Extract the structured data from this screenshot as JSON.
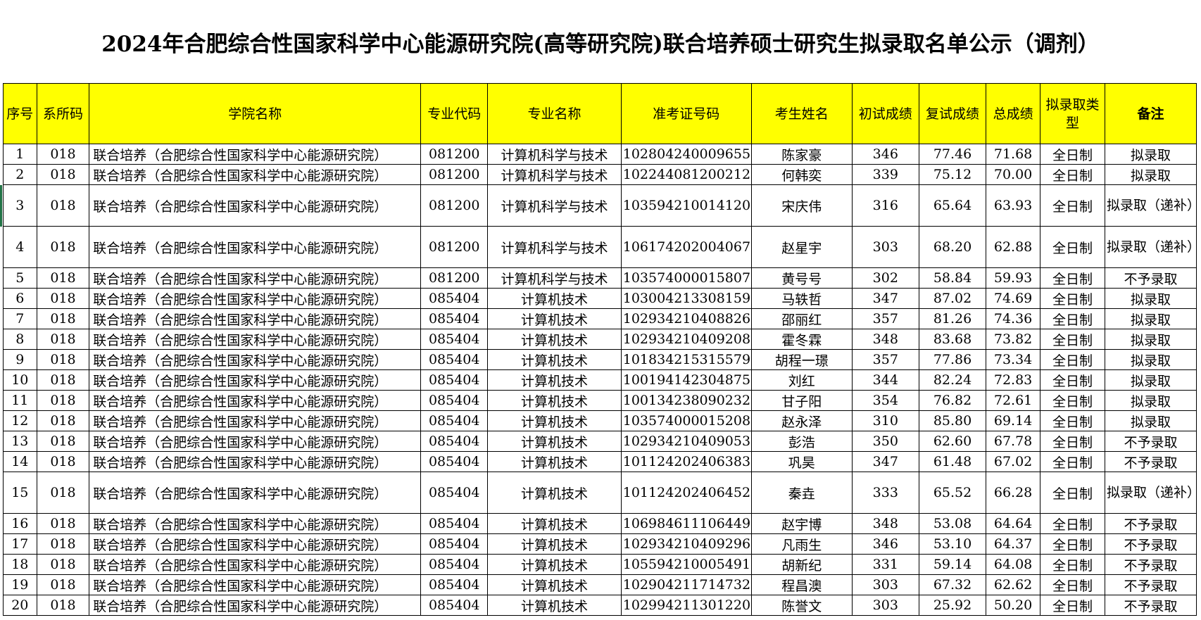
{
  "title": "2024年合肥综合性国家科学中心能源研究院(高等研究院)联合培养硕士研究生拟录取名单公示（调剂）",
  "columns": [
    "序号",
    "系所码",
    "学院名称",
    "专业代码",
    "专业名称",
    "准考证号码",
    "考生姓名",
    "初试成绩",
    "复试成绩",
    "总成绩",
    "拟录取类型",
    "备注"
  ],
  "rows": [
    [
      "1",
      "018",
      "联合培养（合肥综合性国家科学中心能源研究院）",
      "081200",
      "计算机科学与技术",
      "102804240009655",
      "陈家豪",
      "346",
      "77.46",
      "71.68",
      "全日制",
      "拟录取"
    ],
    [
      "2",
      "018",
      "联合培养（合肥综合性国家科学中心能源研究院）",
      "081200",
      "计算机科学与技术",
      "102244081200212",
      "何韩奕",
      "339",
      "75.12",
      "70.00",
      "全日制",
      "拟录取"
    ],
    [
      "3",
      "018",
      "联合培养（合肥综合性国家科学中心能源研究院）",
      "081200",
      "计算机科学与技术",
      "103594210014120",
      "宋庆伟",
      "316",
      "65.64",
      "63.93",
      "全日制",
      "拟录取（递补）"
    ],
    [
      "4",
      "018",
      "联合培养（合肥综合性国家科学中心能源研究院）",
      "081200",
      "计算机科学与技术",
      "106174202004067",
      "赵星宇",
      "303",
      "68.20",
      "62.88",
      "全日制",
      "拟录取（递补）"
    ],
    [
      "5",
      "018",
      "联合培养（合肥综合性国家科学中心能源研究院）",
      "081200",
      "计算机科学与技术",
      "103574000015807",
      "黄号号",
      "302",
      "58.84",
      "59.93",
      "全日制",
      "不予录取"
    ],
    [
      "6",
      "018",
      "联合培养（合肥综合性国家科学中心能源研究院）",
      "085404",
      "计算机技术",
      "103004213308159",
      "马轶哲",
      "347",
      "87.02",
      "74.69",
      "全日制",
      "拟录取"
    ],
    [
      "7",
      "018",
      "联合培养（合肥综合性国家科学中心能源研究院）",
      "085404",
      "计算机技术",
      "102934210408826",
      "邵丽红",
      "357",
      "81.26",
      "74.36",
      "全日制",
      "拟录取"
    ],
    [
      "8",
      "018",
      "联合培养（合肥综合性国家科学中心能源研究院）",
      "085404",
      "计算机技术",
      "102934210409208",
      "霍冬霖",
      "348",
      "83.68",
      "73.82",
      "全日制",
      "拟录取"
    ],
    [
      "9",
      "018",
      "联合培养（合肥综合性国家科学中心能源研究院）",
      "085404",
      "计算机技术",
      "101834215315579",
      "胡程一璟",
      "357",
      "77.86",
      "73.34",
      "全日制",
      "拟录取"
    ],
    [
      "10",
      "018",
      "联合培养（合肥综合性国家科学中心能源研究院）",
      "085404",
      "计算机技术",
      "100194142304875",
      "刘红",
      "344",
      "82.24",
      "72.83",
      "全日制",
      "拟录取"
    ],
    [
      "11",
      "018",
      "联合培养（合肥综合性国家科学中心能源研究院）",
      "085404",
      "计算机技术",
      "100134238090232",
      "甘子阳",
      "354",
      "76.82",
      "72.61",
      "全日制",
      "拟录取"
    ],
    [
      "12",
      "018",
      "联合培养（合肥综合性国家科学中心能源研究院）",
      "085404",
      "计算机技术",
      "103574000015208",
      "赵永泽",
      "310",
      "85.80",
      "69.14",
      "全日制",
      "拟录取"
    ],
    [
      "13",
      "018",
      "联合培养（合肥综合性国家科学中心能源研究院）",
      "085404",
      "计算机技术",
      "102934210409053",
      "彭浩",
      "350",
      "62.60",
      "67.78",
      "全日制",
      "不予录取"
    ],
    [
      "14",
      "018",
      "联合培养（合肥综合性国家科学中心能源研究院）",
      "085404",
      "计算机技术",
      "101124202406383",
      "巩昊",
      "347",
      "61.48",
      "67.02",
      "全日制",
      "不予录取"
    ],
    [
      "15",
      "018",
      "联合培养（合肥综合性国家科学中心能源研究院）",
      "085404",
      "计算机技术",
      "101124202406452",
      "秦垚",
      "333",
      "65.52",
      "66.28",
      "全日制",
      "拟录取（递补）"
    ],
    [
      "16",
      "018",
      "联合培养（合肥综合性国家科学中心能源研究院）",
      "085404",
      "计算机技术",
      "106984611106449",
      "赵宇博",
      "348",
      "53.08",
      "64.64",
      "全日制",
      "不予录取"
    ],
    [
      "17",
      "018",
      "联合培养（合肥综合性国家科学中心能源研究院）",
      "085404",
      "计算机技术",
      "102934210409296",
      "凡雨生",
      "346",
      "53.10",
      "64.37",
      "全日制",
      "不予录取"
    ],
    [
      "18",
      "018",
      "联合培养（合肥综合性国家科学中心能源研究院）",
      "085404",
      "计算机技术",
      "105594210005491",
      "胡新纪",
      "331",
      "59.14",
      "64.08",
      "全日制",
      "不予录取"
    ],
    [
      "19",
      "018",
      "联合培养（合肥综合性国家科学中心能源研究院）",
      "085404",
      "计算机技术",
      "102904211714732",
      "程昌澳",
      "303",
      "67.32",
      "62.62",
      "全日制",
      "不予录取"
    ],
    [
      "20",
      "018",
      "联合培养（合肥综合性国家科学中心能源研究院）",
      "085404",
      "计算机技术",
      "102994211301220",
      "陈誉文",
      "303",
      "25.92",
      "50.20",
      "全日制",
      "不予录取"
    ]
  ],
  "colors": {
    "header_bg": "#ffff00",
    "selection": "#217346"
  }
}
